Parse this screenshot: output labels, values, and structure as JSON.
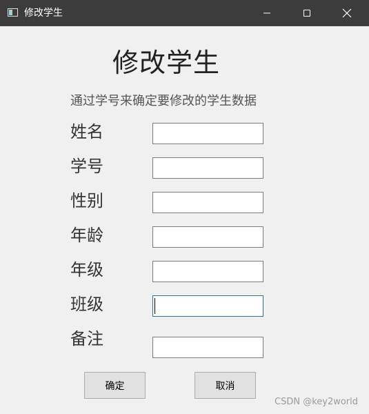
{
  "window": {
    "title": "修改学生",
    "icon": "app-window-icon",
    "controls": [
      "minimize-icon",
      "maximize-icon",
      "close-icon"
    ]
  },
  "form": {
    "title": "修改学生",
    "subtitle": "通过学号来确定要修改的学生数据",
    "fields": [
      {
        "label": "姓名",
        "value": ""
      },
      {
        "label": "学号",
        "value": ""
      },
      {
        "label": "性别",
        "value": ""
      },
      {
        "label": "年龄",
        "value": ""
      },
      {
        "label": "年级",
        "value": ""
      },
      {
        "label": "班级",
        "value": ""
      },
      {
        "label": "备注",
        "value": ""
      }
    ],
    "focused_field": "班级"
  },
  "buttons": {
    "ok": "确定",
    "cancel": "取消"
  },
  "watermark": "CSDN @key2world",
  "colors": {
    "titlebar": "#3c3c3c",
    "window_bg": "#f0f0f0",
    "focus_border": "#2f6f90"
  }
}
